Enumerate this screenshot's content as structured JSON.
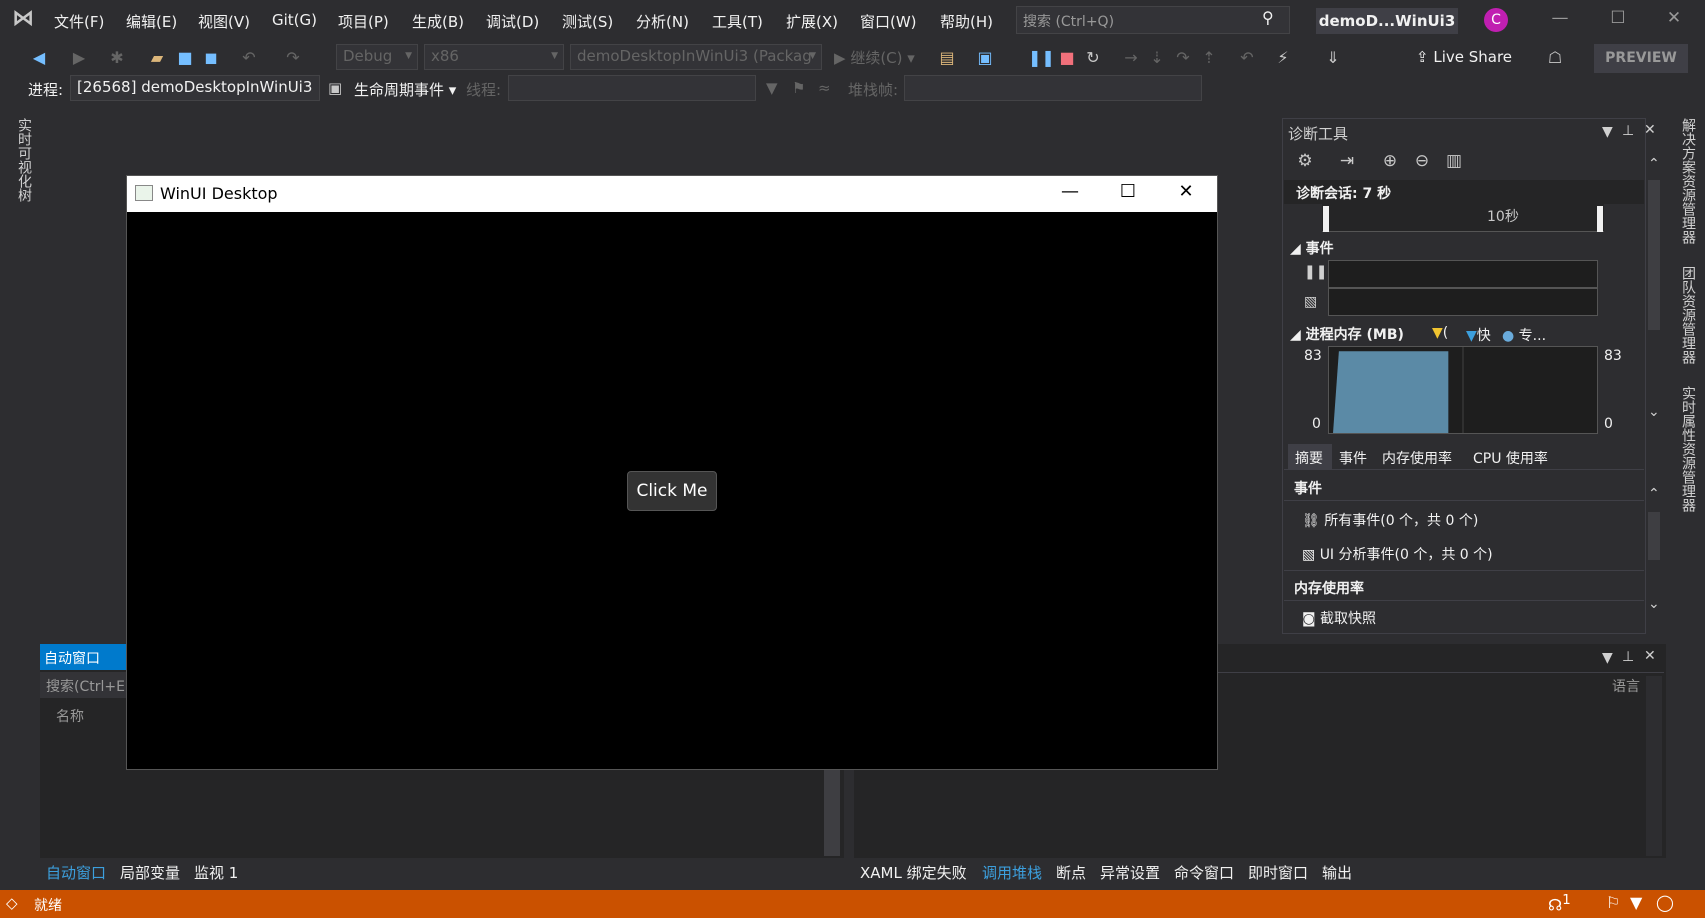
{
  "menu": {
    "items": [
      "文件(F)",
      "编辑(E)",
      "视图(V)",
      "Git(G)",
      "项目(P)",
      "生成(B)",
      "调试(D)",
      "测试(S)",
      "分析(N)",
      "工具(T)",
      "扩展(X)",
      "窗口(W)",
      "帮助(H)"
    ],
    "search_placeholder": "搜索 (Ctrl+Q)",
    "solution_title": "demoD...WinUi3",
    "avatar_letter": "C"
  },
  "toolbar": {
    "config": "Debug",
    "platform": "x86",
    "startup": "demoDesktopInWinUi3 (Packag",
    "continue": "继续(C)",
    "live_share": "Live Share",
    "preview": "PREVIEW"
  },
  "debugbar": {
    "process_label": "进程:",
    "process_value": "[26568] demoDesktopInWinUi3",
    "lifecycle": "生命周期事件",
    "thread_label": "线程:",
    "stack_label": "堆栈帧:"
  },
  "side_tabs": {
    "left": "实时可视化树",
    "right": [
      "解决方案资源管理器",
      "团队资源管理器",
      "实时属性资源管理器"
    ]
  },
  "diag": {
    "title": "诊断工具",
    "session": "诊断会话: 7 秒",
    "timeline_label": "10秒",
    "events_header": "事件",
    "memory_header": "进程内存 (MB)",
    "legend": [
      "(",
      "快",
      "专..."
    ],
    "y_max": "83",
    "y_min": "0",
    "tabs": [
      "摘要",
      "事件",
      "内存使用率",
      "CPU 使用率"
    ],
    "summary_events_header": "事件",
    "all_events": "所有事件(0 个，共 0 个)",
    "ui_events": "UI 分析事件(0 个，共 0 个)",
    "memory_usage_header": "内存使用率",
    "snapshot": "截取快照",
    "memory_fill_fraction": 0.95
  },
  "auto_panel": {
    "tab": "自动窗口",
    "search": "搜索(Ctrl+E",
    "col_name": "名称",
    "lang_col": "语言",
    "bottom_tabs": [
      "自动窗口",
      "局部变量",
      "监视 1"
    ]
  },
  "right_bottom_tabs": [
    "XAML 绑定失败",
    "调用堆栈",
    "断点",
    "异常设置",
    "命令窗口",
    "即时窗口",
    "输出"
  ],
  "app": {
    "title": "WinUI Desktop",
    "button": "Click Me"
  },
  "status": {
    "text": "就绪",
    "badge": "1",
    "color": "#ca5100"
  }
}
